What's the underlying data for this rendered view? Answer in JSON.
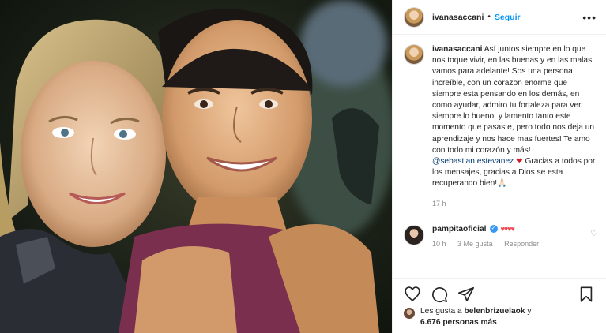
{
  "post": {
    "username": "ivanasaccani",
    "separator": "•",
    "follow_label": "Seguir",
    "more_icon": "more-horizontal-icon",
    "caption": {
      "username": "ivanasaccani",
      "text_part1": "Así juntos siempre en lo que nos toque vivir, en las buenas y en las malas vamos para adelante! Sos una persona increíble, con un corazon enorme que siempre esta pensando en los demás, en como ayudar, admiro tu fortaleza para ver siempre lo bueno, y lamento tanto este momento que pasaste, pero todo nos deja un aprendizaje y nos hace mas fuertes! Te amo con todo mi corazón y más!",
      "mention": "@sebastian.estevanez",
      "heart": "❤",
      "text_part2": "Gracias a todos por los mensajes, gracias a Dios se esta recuperando bien!🙏🏻",
      "time": "17 h"
    },
    "reply": {
      "username": "pampitaoficial",
      "verified": "✓",
      "hearts": "♥♥♥♥",
      "time": "10 h",
      "likes": "3 Me gusta",
      "reply_label": "Responder"
    },
    "likes": {
      "prefix": "Les gusta a",
      "user": "belenbrizuelaok",
      "conjunction": "y",
      "others": "6.676 personas más"
    }
  },
  "colors": {
    "link": "#0095f6",
    "mention": "#00376b",
    "heart": "#d11b2a",
    "verified": "#3897f0",
    "muted": "#8e8e8e"
  }
}
